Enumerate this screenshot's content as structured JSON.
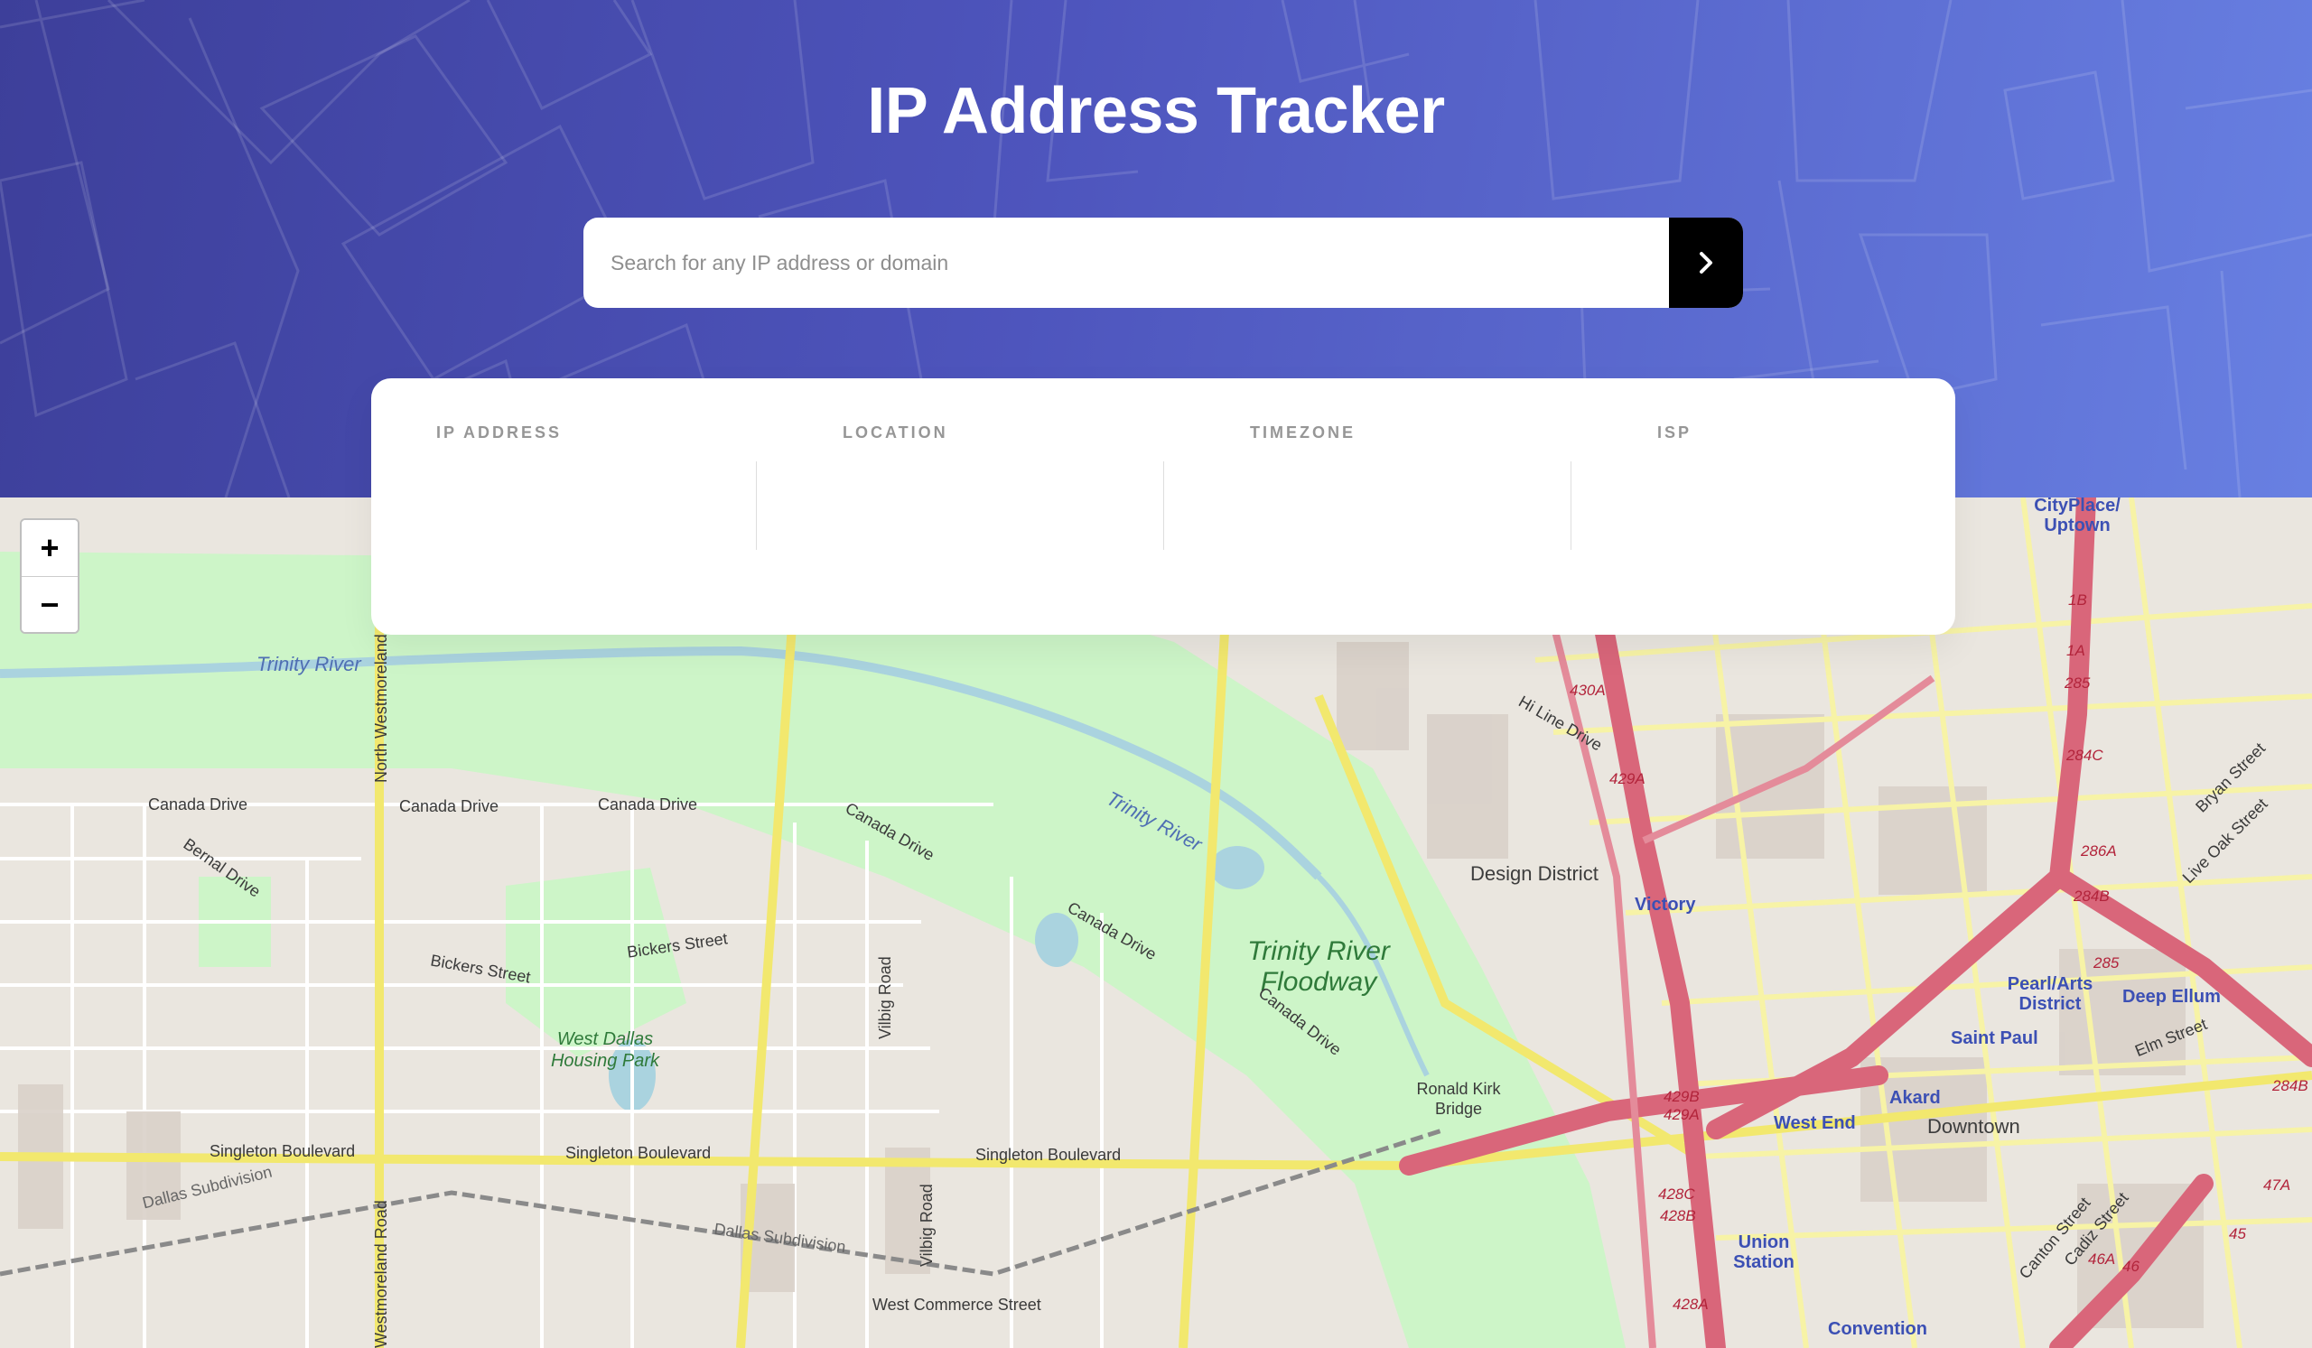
{
  "header": {
    "title": "IP Address Tracker"
  },
  "search": {
    "placeholder": "Search for any IP address or domain",
    "value": "",
    "submit_icon": "chevron-right-icon"
  },
  "stats": {
    "ip_address": {
      "label": "IP ADDRESS",
      "value": ""
    },
    "location": {
      "label": "LOCATION",
      "value": ""
    },
    "timezone": {
      "label": "TIMEZONE",
      "value": ""
    },
    "isp": {
      "label": "ISP",
      "value": ""
    }
  },
  "map": {
    "zoom_in": "+",
    "zoom_out": "−",
    "labels": {
      "trinity_river_1": "Trinity River",
      "trinity_river_2": "Trinity River",
      "floodway": "Trinity River Floodway",
      "design_district": "Design District",
      "victory": "Victory",
      "cityplace": "CityPlace/ Uptown",
      "pearl_arts": "Pearl/Arts District",
      "deep_ellum": "Deep Ellum",
      "saint_paul": "Saint Paul",
      "akard": "Akard",
      "west_end": "West End",
      "downtown": "Downtown",
      "union_station": "Union Station",
      "convention": "Convention",
      "west_dallas_park": "West Dallas Housing Park",
      "ronald_kirk": "Ronald Kirk Bridge",
      "canada_drive_1": "Canada Drive",
      "canada_drive_2": "Canada Drive",
      "canada_drive_3": "Canada Drive",
      "canada_drive_4": "Canada Drive",
      "canada_drive_5": "Canada Drive",
      "canada_drive_6": "Canada Drive",
      "bickers_1": "Bickers Street",
      "bickers_2": "Bickers Street",
      "singleton_1": "Singleton Boulevard",
      "singleton_2": "Singleton Boulevard",
      "singleton_3": "Singleton Boulevard",
      "dallas_sub_1": "Dallas Subdivision",
      "dallas_sub_2": "Dallas Subdivision",
      "west_commerce": "West Commerce Street",
      "vilbig_1": "Vilbig Road",
      "vilbig_2": "Vilbig Road",
      "westmoreland": "Westmoreland Road",
      "north_westmoreland": "North Westmoreland",
      "bernal": "Bernal Drive",
      "hi_line": "Hi Line Drive",
      "bryan": "Bryan Street",
      "live_oak": "Live Oak Street",
      "elm": "Elm Street",
      "canton": "Canton Street",
      "cadiz": "Cadiz Street",
      "s_430a": "430A",
      "s_429a": "429A",
      "s_429b": "429B",
      "s_429a_2": "429A",
      "s_428c": "428C",
      "s_428b": "428B",
      "s_428a": "428A",
      "s_1b": "1B",
      "s_1a": "1A",
      "s_285": "285",
      "s_284c": "284C",
      "s_286a": "286A",
      "s_284b": "284B",
      "s_285_2": "285",
      "s_284b_2": "284B",
      "s_47a": "47A",
      "s_45": "45",
      "s_46a": "46A",
      "s_46": "46"
    }
  },
  "colors": {
    "hero_gradient_start": "#3d3f9a",
    "hero_gradient_end": "#6880e2",
    "search_button": "#000000",
    "card_background": "#ffffff",
    "label_gray": "#969696",
    "park_green": "#cdf5c8",
    "highway_red": "#d9667a",
    "road_yellow": "#f7f3a6",
    "water_blue": "#aad3df"
  }
}
